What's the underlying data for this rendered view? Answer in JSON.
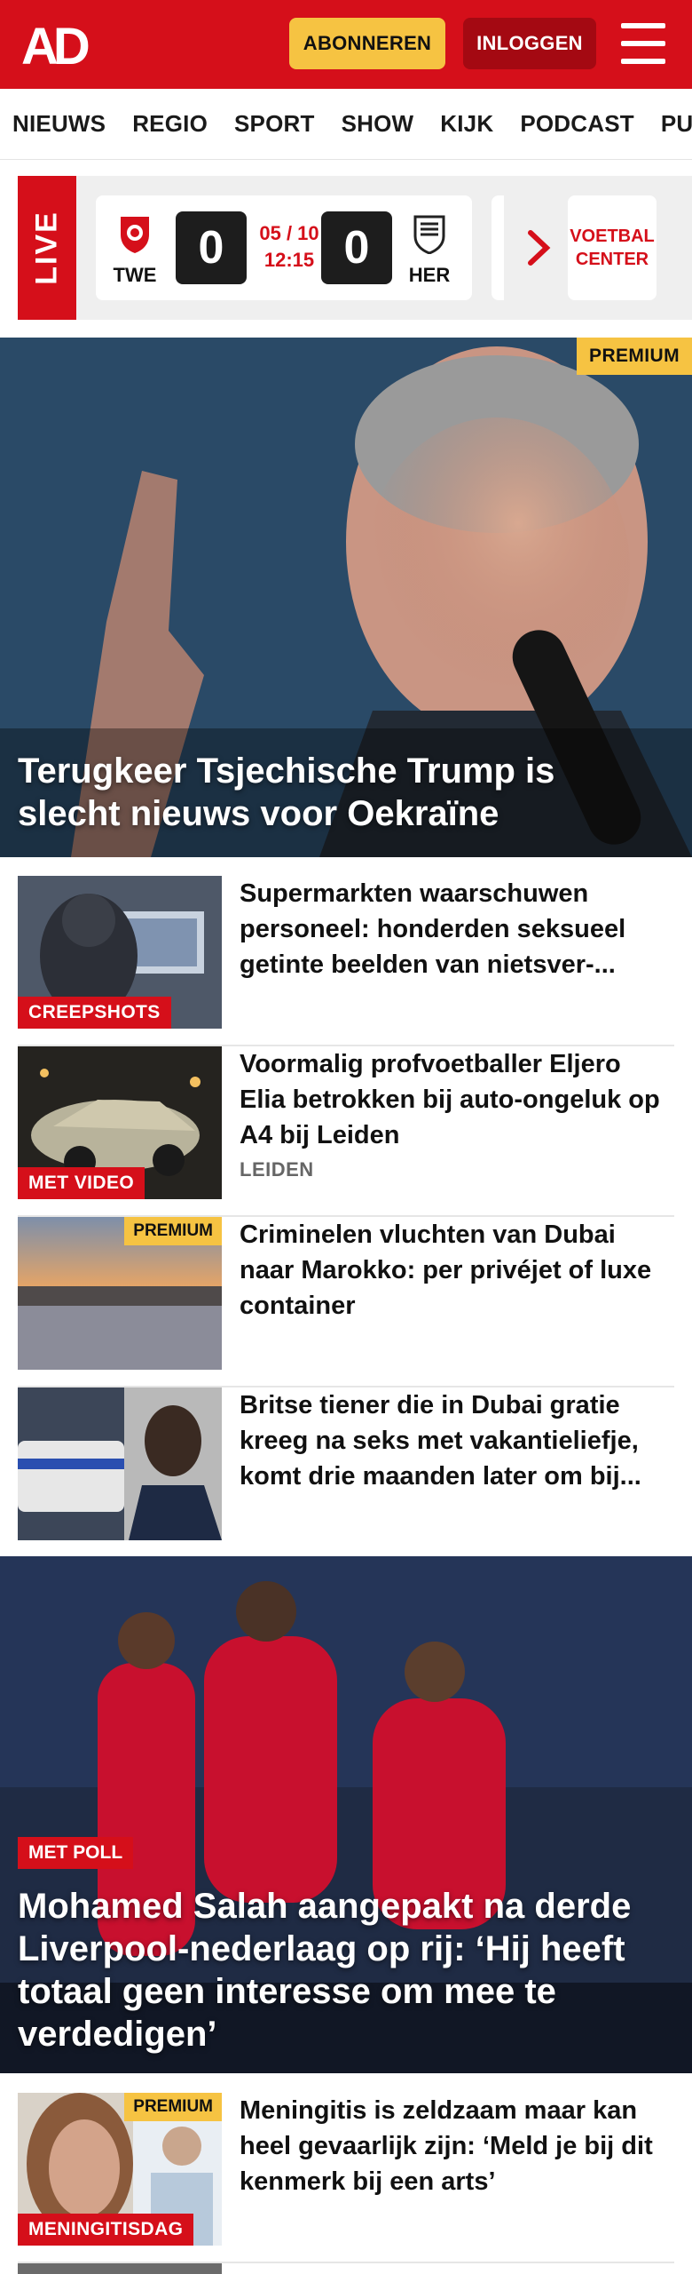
{
  "header": {
    "logo_text": "AD",
    "subscribe_label": "ABONNEREN",
    "login_label": "INLOGGEN"
  },
  "nav": {
    "items": [
      "NIEUWS",
      "REGIO",
      "SPORT",
      "SHOW",
      "KIJK",
      "PODCAST",
      "PUZZ"
    ]
  },
  "live": {
    "label": "LIVE",
    "match": {
      "home": "TWE",
      "away": "HER",
      "home_score": "0",
      "away_score": "0",
      "date": "05 / 10",
      "time": "12:15"
    },
    "voetbal_center": "VOETBAL CENTER"
  },
  "hero1": {
    "badge": "PREMIUM",
    "title": "Terugkeer Tsjechische Trump is slecht nieuws voor Oekraïne"
  },
  "articles": [
    {
      "title": "Supermarkten waarschuwen personeel: honderden seksueel getinte beelden van nietsver-...",
      "label": "CREEPSHOTS",
      "sub": "",
      "premium": ""
    },
    {
      "title": "Voormalig profvoetballer Eljero Elia betrokken bij auto-ongeluk op A4 bij Leiden",
      "label": "MET VIDEO",
      "sub": "LEIDEN",
      "premium": ""
    },
    {
      "title": "Criminelen vluchten van Dubai naar Marokko: per privéjet of luxe container",
      "label": "",
      "sub": "",
      "premium": "PREMIUM"
    },
    {
      "title": "Britse tiener die in Dubai gratie kreeg na seks met vakantieliefje, komt drie maanden later om bij...",
      "label": "",
      "sub": "",
      "premium": ""
    }
  ],
  "hero2": {
    "label": "MET POLL",
    "title": "Mohamed Salah aangepakt na derde Liverpool-nederlaag op rij: ‘Hij heeft totaal geen interesse om mee te verdedigen’"
  },
  "articles2": [
    {
      "title": "Meningitis is zeldzaam maar kan heel gevaarlijk zijn: ‘Meld je bij dit kenmerk bij een arts’",
      "label": "MENINGITISDAG",
      "premium": "PREMIUM"
    }
  ],
  "colors": {
    "brand_red": "#d50f1a",
    "premium_yellow": "#f6c342"
  }
}
